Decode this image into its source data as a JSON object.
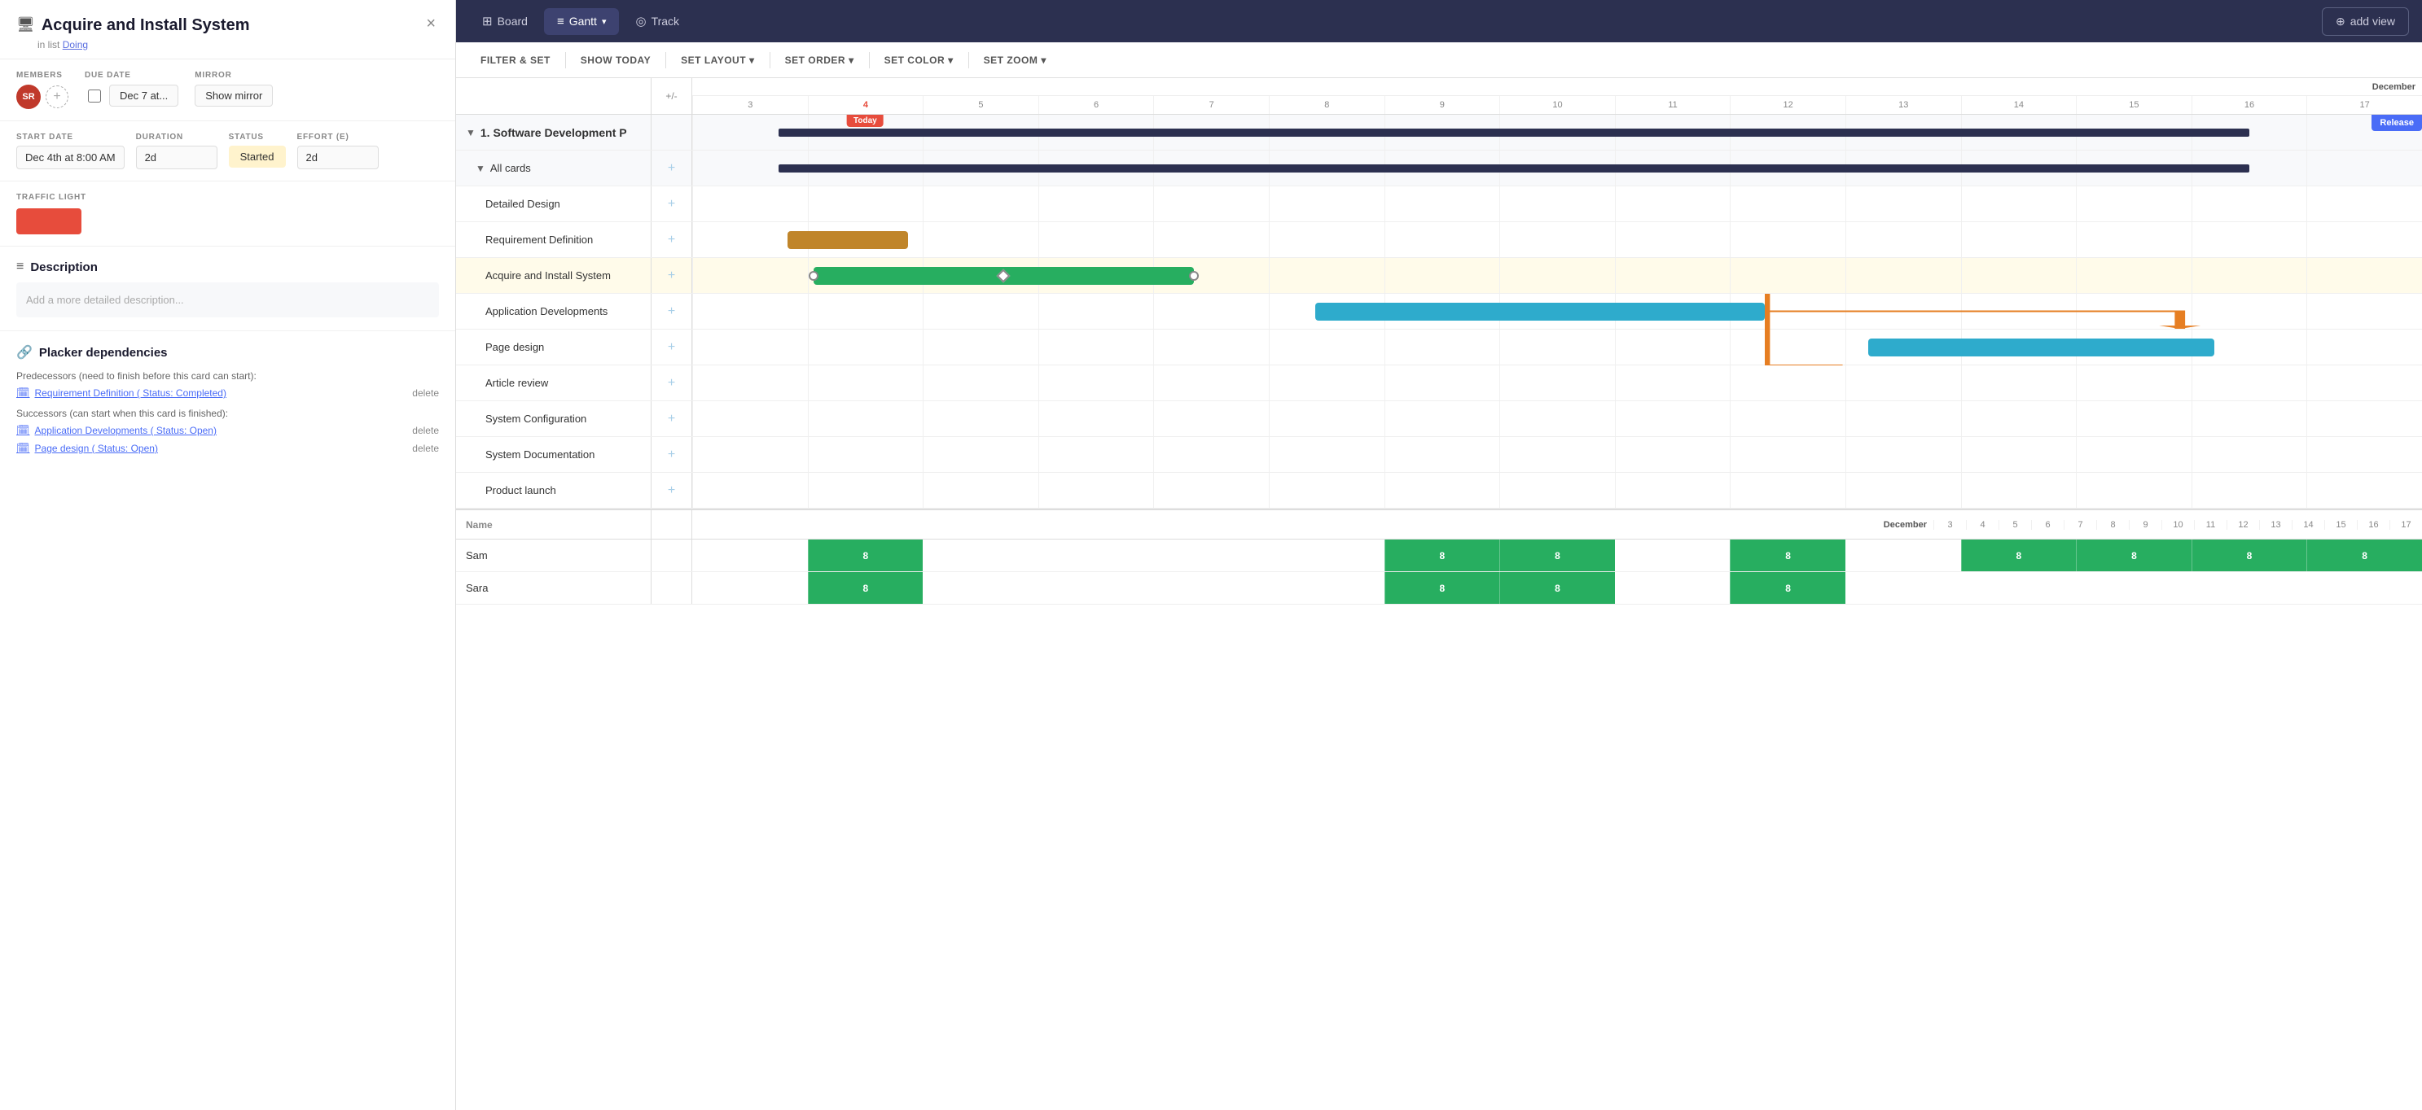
{
  "card": {
    "title": "Acquire and Install System",
    "list": "Doing",
    "close_label": "×",
    "members_label": "MEMBERS",
    "due_date_label": "DUE DATE",
    "mirror_label": "MIRROR",
    "due_date_value": "Dec 7 at...",
    "mirror_btn": "Show mirror",
    "start_date_label": "START DATE",
    "start_date_value": "Dec 4th at 8:00 AM",
    "duration_label": "DURATION",
    "duration_value": "2d",
    "status_label": "STATUS",
    "status_value": "Started",
    "effort_label": "EFFORT (E)",
    "effort_value": "2d",
    "traffic_light_label": "TRAFFIC LIGHT",
    "description_title": "Description",
    "description_placeholder": "Add a more detailed description...",
    "deps_title": "Placker dependencies",
    "predecessors_label": "Predecessors (need to finish before this card can start):",
    "successors_label": "Successors (can start when this card is finished):",
    "predecessors": [
      {
        "text": "Requirement Definition ( Status: Completed)",
        "delete": "delete"
      }
    ],
    "successors": [
      {
        "text": "Application Developments ( Status: Open)",
        "delete": "delete"
      },
      {
        "text": "Page design ( Status: Open)",
        "delete": "delete"
      }
    ],
    "avatar_initials": "SR"
  },
  "nav": {
    "board_label": "Board",
    "gantt_label": "Gantt",
    "track_label": "Track",
    "add_view_label": "add view"
  },
  "toolbar": {
    "filter_label": "FILTER & SET",
    "show_today_label": "SHOW TODAY",
    "set_layout_label": "SET LAYOUT",
    "set_order_label": "SET ORDER",
    "set_color_label": "SET COLOR",
    "set_zoom_label": "SET ZOOM"
  },
  "gantt": {
    "month_label": "December",
    "days": [
      "3",
      "4",
      "5",
      "6",
      "7",
      "8",
      "9",
      "10",
      "11",
      "12",
      "13",
      "14",
      "15",
      "16",
      "17"
    ],
    "pm_col_label": "+/-",
    "today_badge": "Today",
    "release_badge": "Release",
    "group_title": "1. Software Development P",
    "all_cards_label": "All cards",
    "rows": [
      {
        "name": "Detailed Design",
        "type": "task"
      },
      {
        "name": "Requirement Definition",
        "type": "task",
        "bar": {
          "color": "#c0852a",
          "start": 0,
          "width": 1
        }
      },
      {
        "name": "Acquire and Install System",
        "type": "task",
        "highlight": true,
        "bar": {
          "color": "#27ae60",
          "start": 1,
          "width": 4
        }
      },
      {
        "name": "Application Developments",
        "type": "task",
        "bar": {
          "color": "#2eabcc",
          "start": 5,
          "width": 4
        }
      },
      {
        "name": "Page design",
        "type": "task",
        "bar": {
          "color": "#2eabcc",
          "start": 10,
          "width": 3
        }
      },
      {
        "name": "Article review",
        "type": "task"
      },
      {
        "name": "System Configuration",
        "type": "task"
      },
      {
        "name": "System Documentation",
        "type": "task"
      },
      {
        "name": "Product launch",
        "type": "task"
      }
    ],
    "name_col_label": "Name",
    "resource_month": "December",
    "resource_days": [
      "3",
      "4",
      "5",
      "6",
      "7",
      "8",
      "9",
      "10",
      "11",
      "12",
      "13",
      "14",
      "15",
      "16",
      "17"
    ],
    "resources": [
      {
        "name": "Sam",
        "cells": [
          0,
          8,
          0,
          0,
          0,
          0,
          8,
          8,
          0,
          8,
          0,
          8,
          8,
          8,
          8
        ]
      },
      {
        "name": "Sara",
        "cells": [
          0,
          8,
          0,
          0,
          0,
          0,
          8,
          8,
          0,
          8,
          0,
          0,
          0,
          0,
          0
        ]
      }
    ]
  }
}
